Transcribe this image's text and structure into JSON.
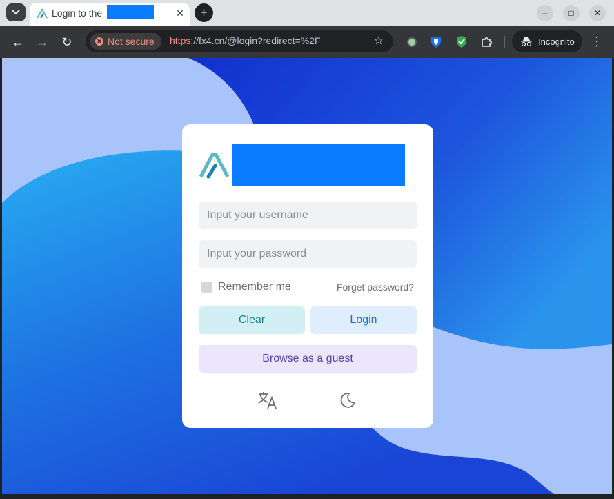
{
  "tab": {
    "title": "Login to the",
    "close_glyph": "✕"
  },
  "new_tab_glyph": "+",
  "window_controls": {
    "minimize": "–",
    "maximize": "□",
    "close": "✕"
  },
  "toolbar": {
    "back_glyph": "←",
    "forward_glyph": "→",
    "reload_glyph": "↻",
    "security_label": "Not secure",
    "url_scheme": "https",
    "url_rest": "://fx4.cn/@login?redirect=%2F",
    "star_glyph": "☆",
    "incognito_label": "Incognito",
    "menu_glyph": "⋮"
  },
  "login": {
    "username_placeholder": "Input your username",
    "password_placeholder": "Input your password",
    "remember_label": "Remember me",
    "forget_label": "Forget password?",
    "clear_label": "Clear",
    "login_label": "Login",
    "guest_label": "Browse as a guest"
  },
  "icons": [
    "translate-icon",
    "dark-mode-icon"
  ],
  "colors": {
    "redaction": "#0a7cff",
    "brand_teal": "#5ab8c8",
    "page_bg_light": "#a9c4fb",
    "page_bg_dark": "#1636d6"
  }
}
